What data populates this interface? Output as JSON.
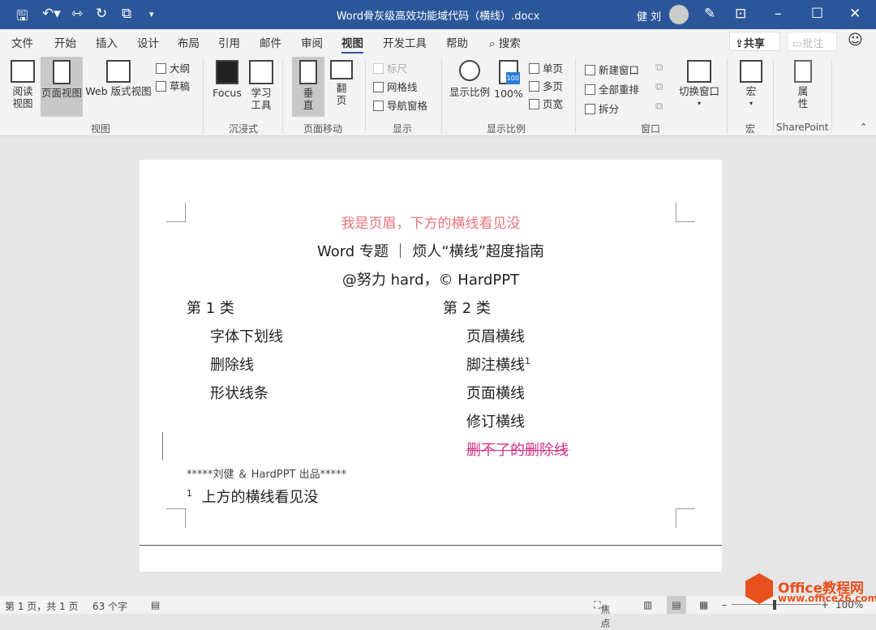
{
  "titlebar": {
    "title": "Word骨灰级高效功能域代码（横线）.docx",
    "user": "健 刘",
    "icons": [
      "save-icon",
      "undo-icon",
      "width-icon",
      "redo-icon",
      "present-icon",
      "customize-icon",
      "avatar",
      "pen-icon",
      "ribbon-display-icon",
      "minimize-icon",
      "maximize-icon",
      "close-icon"
    ]
  },
  "tabs": [
    "文件",
    "开始",
    "插入",
    "设计",
    "布局",
    "引用",
    "邮件",
    "审阅",
    "视图",
    "开发工具",
    "帮助"
  ],
  "active_tab": "视图",
  "search": "搜索",
  "share": "共享",
  "comment": "批注",
  "ribbon": {
    "views": {
      "read": "阅读视图",
      "print": "页面视图",
      "web": "Web 版式视图",
      "outline": "大纲",
      "draft": "草稿",
      "label": "视图"
    },
    "immersive": {
      "focus": "Focus",
      "learn": "学习工具",
      "label": "沉浸式"
    },
    "movement": {
      "vertical": "垂直",
      "flip": "翻页",
      "label": "页面移动"
    },
    "show": {
      "ruler": "标尺",
      "grid": "网格线",
      "nav": "导航窗格",
      "label": "显示"
    },
    "zoom": {
      "zoom": "显示比例",
      "hundred": "100%",
      "one": "单页",
      "multi": "多页",
      "width": "页宽",
      "label": "显示比例",
      "badge": "100"
    },
    "window": {
      "new": "新建窗口",
      "arrange": "全部重排",
      "split": "拆分",
      "switch": "切换窗口",
      "label": "窗口"
    },
    "macros": {
      "macro": "宏",
      "label": "宏"
    },
    "sharepoint": {
      "props": "属性",
      "label": "SharePoint"
    }
  },
  "document": {
    "header": "我是页眉，下方的横线看见没",
    "title": "Word 专题 ｜ 烦人“横线”超度指南",
    "byline": "@努力 hard，© HardPPT",
    "col1": {
      "heading": "第 1 类",
      "items": [
        "字体下划线",
        "删除线",
        "形状线条"
      ]
    },
    "col2": {
      "heading": "第 2 类",
      "items": [
        "页眉横线",
        "脚注横线",
        "页面横线",
        "修订横线",
        "删不了的删除线"
      ],
      "footnote_ref": "1"
    },
    "signature": "*****刘健 ＆ HardPPT 出品*****",
    "footnote_num": "1",
    "footnote": "上方的横线看见没"
  },
  "status": {
    "page": "第 1 页，共 1 页",
    "words": "63 个字",
    "focus": "焦点",
    "zoom": "100%",
    "zoom_level": 100
  },
  "watermark": {
    "brand": "Office教程网",
    "url": "www.office26.com"
  },
  "colors": {
    "title_bar": "#2b579a",
    "header_text": "#e8747c",
    "revision": "#d63384"
  }
}
